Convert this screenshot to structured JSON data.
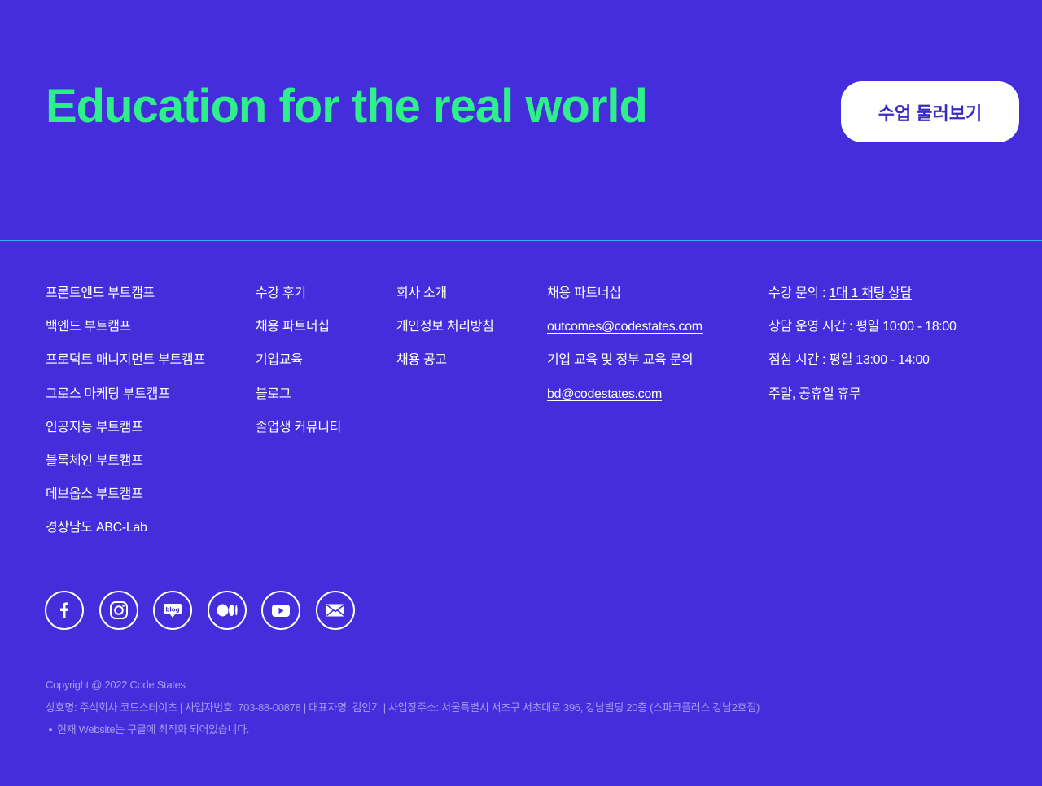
{
  "hero": {
    "title": "Education for the real world",
    "cta_label": "수업 둘러보기",
    "title_color": "#2ef08a",
    "background": "#452ddb"
  },
  "footer": {
    "bootcamps": [
      "프론트엔드 부트캠프",
      "백엔드 부트캠프",
      "프로덕트 매니지먼트 부트캠프",
      "그로스 마케팅 부트캠프",
      "인공지능 부트캠프",
      "블록체인 부트캠프",
      "데브옵스 부트캠프",
      "경상남도 ABC-Lab"
    ],
    "community": [
      "수강 후기",
      "채용 파트너십",
      "기업교육",
      "블로그",
      "졸업생 커뮤니티"
    ],
    "company": [
      "회사 소개",
      "개인정보 처리방침",
      "채용 공고"
    ],
    "contact": {
      "partnership_label": "채용 파트너십",
      "partnership_email": "outcomes@codestates.com",
      "corporate_label": "기업 교육 및 정부 교육 문의",
      "corporate_email": "bd@codestates.com"
    },
    "support": {
      "inquiry_label": "수강 문의 : ",
      "inquiry_link": "1대 1 채팅 상담",
      "hours": "상담 운영 시간 : 평일 10:00 - 18:00",
      "lunch": "점심 시간 : 평일 13:00 - 14:00",
      "closed": "주말, 공휴일 휴무"
    },
    "social_icons": [
      "facebook-icon",
      "instagram-icon",
      "blog-icon",
      "medium-icon",
      "youtube-icon",
      "mail-icon"
    ],
    "legal": {
      "copyright": "Copyright @ 2022 Code States",
      "business_info": "상호명: 주식회사 코드스테이츠  |  사업자번호: 703-88-00878  |  대표자명: 김인기 |  사업장주소: 서울특별시 서초구 서초대로 396, 강남빌딩 20층 (스파크플러스 강남2호점)",
      "notice": "현재 Website는 구글에 최적화 되어있습니다."
    }
  }
}
